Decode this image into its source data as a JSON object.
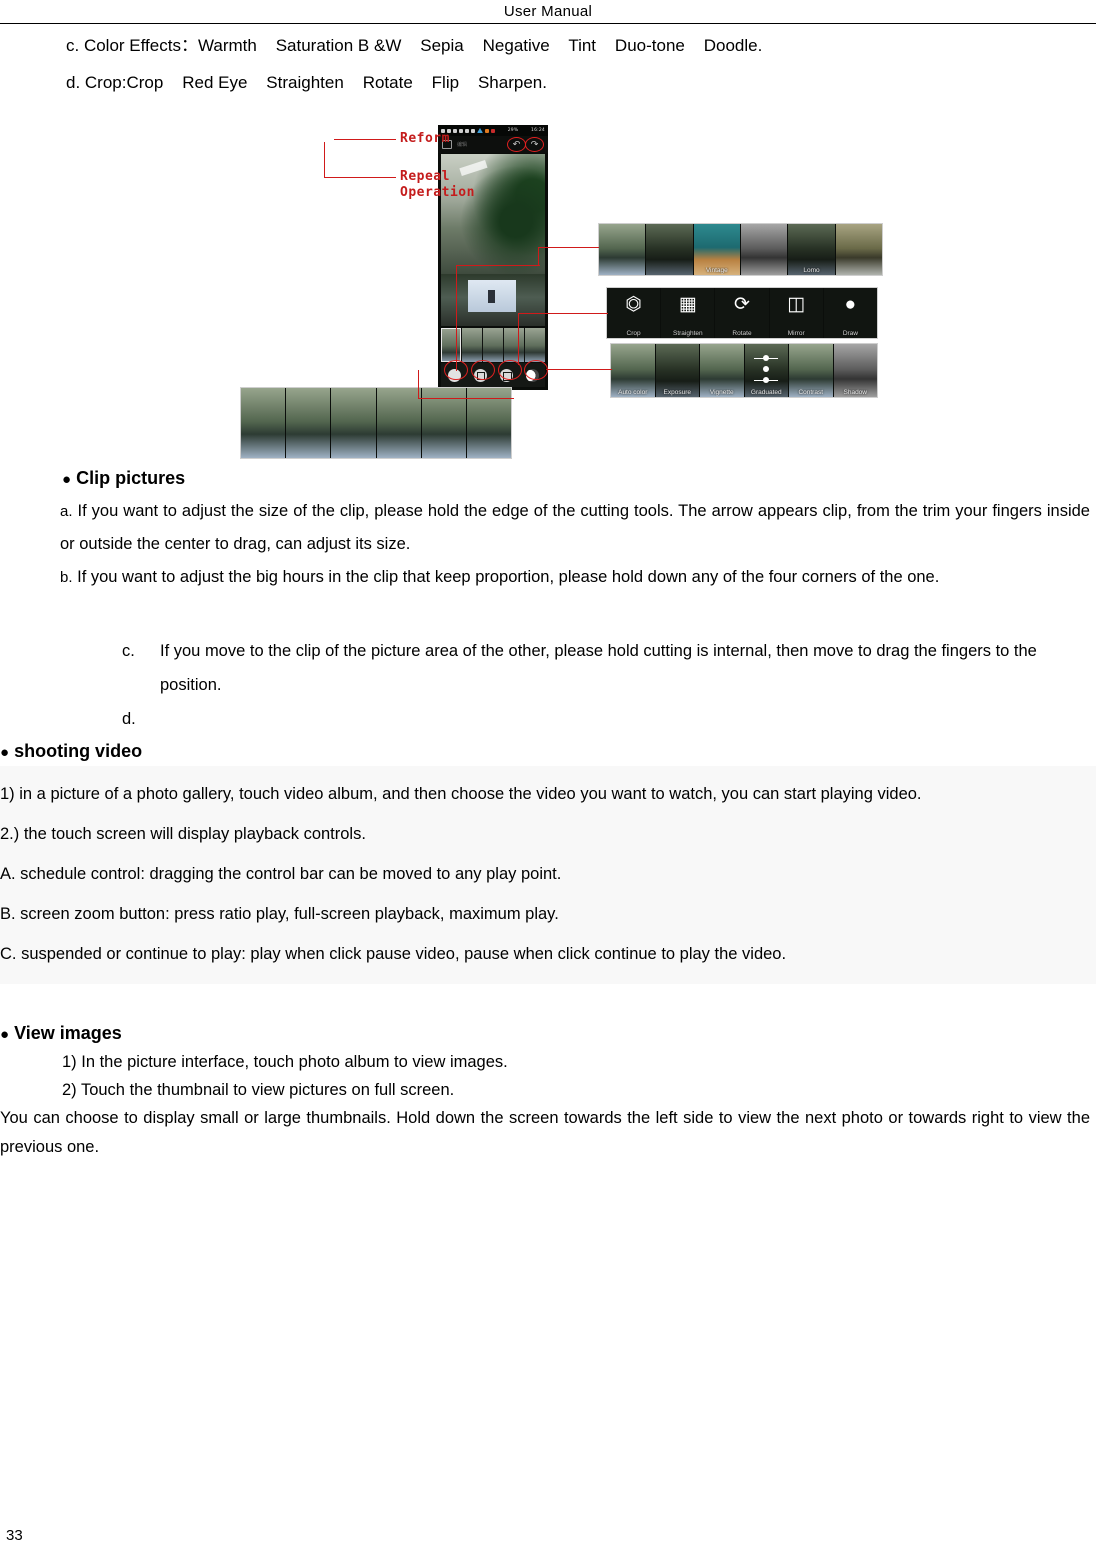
{
  "header": {
    "title": "User    Manual"
  },
  "lines": {
    "color_effects": "c. Color Effects：Warmth    Saturation B &W    Sepia    Negative    Tint    Duo-tone    Doodle.",
    "crop": "d. Crop:Crop    Red Eye    Straighten    Rotate    Flip    Sharpen."
  },
  "figure": {
    "annotations": {
      "reform": "Reform",
      "repeal_operation_line1": "Repeal",
      "repeal_operation_line2": "Operation"
    },
    "status_bar": {
      "battery": "29%",
      "time": "16:24"
    },
    "app_title": "编辑",
    "filter_labels": [
      "",
      "",
      "Vintage",
      "",
      "Lomo",
      ""
    ],
    "tool_labels": [
      "Crop",
      "Straighten",
      "Rotate",
      "Mirror",
      "Draw"
    ],
    "effect_labels": [
      "Auto color",
      "Exposure",
      "Vignette",
      "Graduated",
      "Contrast",
      "Shadow"
    ]
  },
  "clip_pictures": {
    "heading_dot": "●",
    "heading": "Clip pictures",
    "a_marker": "a.",
    "a_text": "If you want to adjust the size of the clip, please hold the edge of the cutting tools. The arrow appears clip, from the trim your fingers inside or outside the center to drag, can adjust its size.",
    "b_marker": "b.",
    "b_text": "If you want to adjust the big hours in the clip that keep proportion, please hold down any of the four corners of the one.",
    "c_marker": "c.",
    "c_text": "If you move to the clip of the picture area of the other, please hold cutting is internal, then move to drag the fingers to the position.",
    "d_marker": "d.",
    "d_text": ""
  },
  "shooting_video": {
    "heading_dot": "●",
    "heading": "shooting video",
    "items": [
      "1) in a picture of a photo gallery, touch video album, and then choose the video you want to watch, you can start playing video.",
      "2.) the touch screen will display playback controls.",
      "A. schedule control: dragging the control bar can be moved to any play point.",
      "B. screen zoom button: press ratio play, full-screen playback, maximum play.",
      "C. suspended or continue to play: play when click pause video, pause when click continue to play the video."
    ]
  },
  "view_images": {
    "heading_dot": "●",
    "heading": "View images",
    "item1": "1) In the picture interface, touch photo album to view images.",
    "item2": "2) Touch the thumbnail to view pictures on full screen.",
    "tail": "You can choose to display small or large thumbnails. Hold down the screen towards the left side to view the next photo or towards right to view the previous one."
  },
  "footer": {
    "page_number": "33"
  },
  "colors": {
    "annotation_red": "#c41c1c",
    "shaded_background": "#f8f8f8"
  }
}
